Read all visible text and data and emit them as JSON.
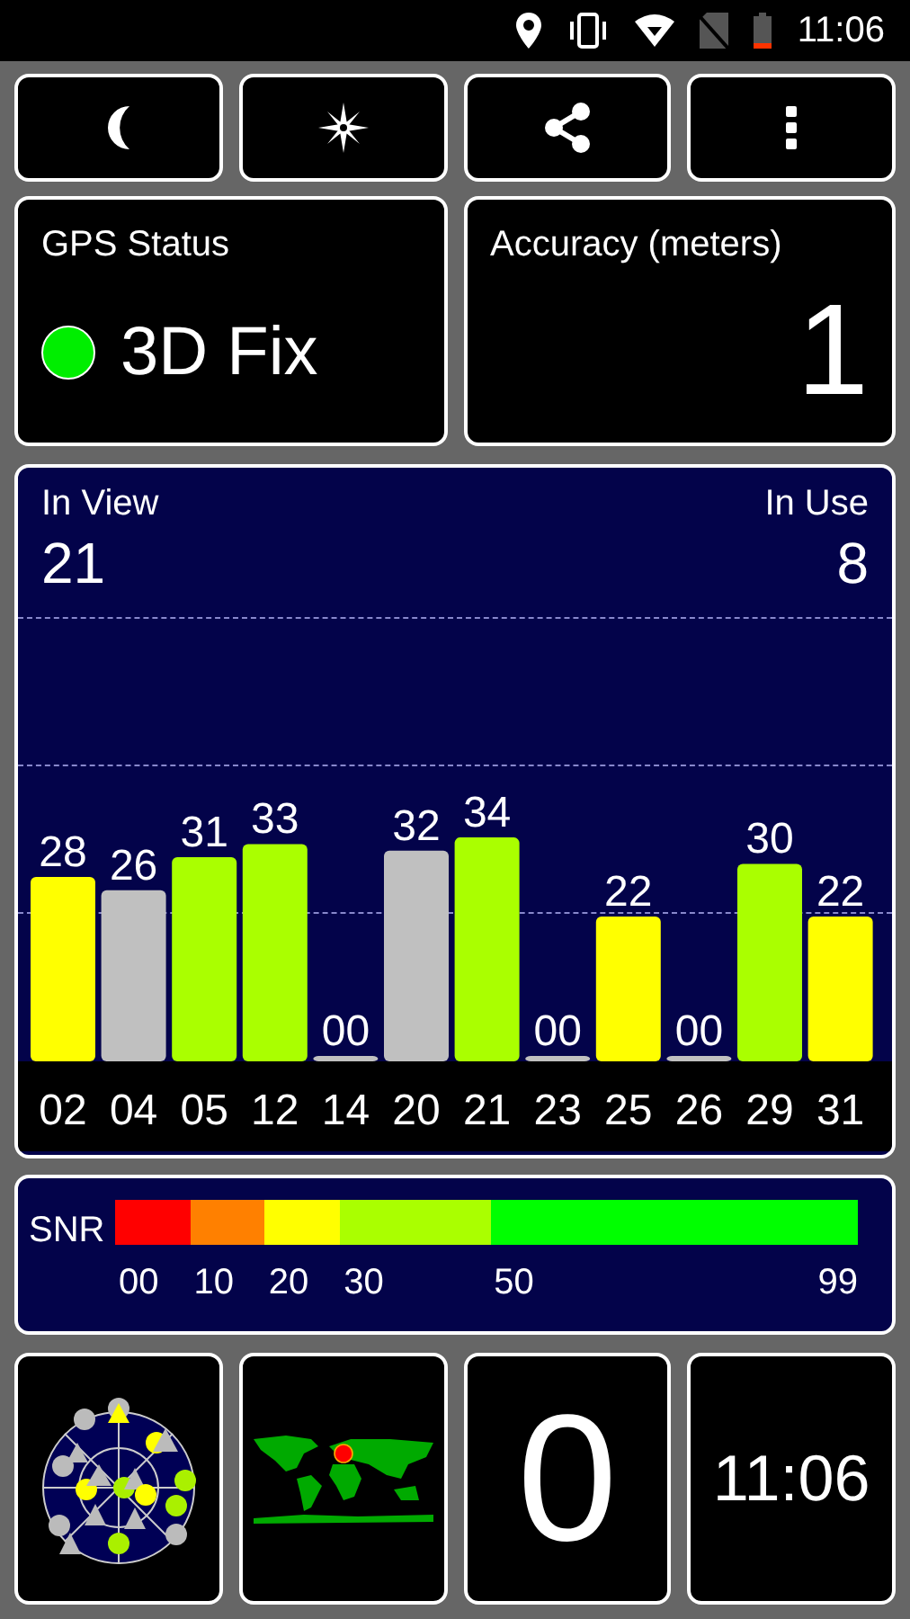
{
  "status_bar": {
    "time": "11:06"
  },
  "toolbar": {
    "buttons": [
      {
        "kind": "night"
      },
      {
        "kind": "compass"
      },
      {
        "kind": "share"
      },
      {
        "kind": "more"
      }
    ]
  },
  "gps_status": {
    "title": "GPS Status",
    "fix": "3D Fix",
    "color": "#00ee00"
  },
  "accuracy": {
    "title": "Accuracy (meters)",
    "value": "1"
  },
  "satellites": {
    "in_view_label": "In View",
    "in_view": "21",
    "in_use_label": "In Use",
    "in_use": "8",
    "in_use_flags": [
      true,
      false,
      true,
      true,
      false,
      false,
      true,
      false,
      true,
      false,
      true,
      true
    ],
    "chart_data": {
      "type": "bar",
      "categories": [
        "02",
        "04",
        "05",
        "12",
        "14",
        "20",
        "21",
        "23",
        "25",
        "26",
        "29",
        "31"
      ],
      "values": [
        28,
        26,
        31,
        33,
        0,
        32,
        34,
        0,
        22,
        0,
        30,
        22
      ],
      "value_labels": [
        "28",
        "26",
        "31",
        "33",
        "00",
        "32",
        "34",
        "00",
        "22",
        "00",
        "30",
        "22"
      ],
      "data_labels": true
    }
  },
  "snr_legend": {
    "label": "SNR",
    "end": "99",
    "segments": [
      {
        "from": "00",
        "color": "#ff0000"
      },
      {
        "from": "10",
        "color": "#ff8000"
      },
      {
        "from": "20",
        "color": "#ffff00"
      },
      {
        "from": "30",
        "color": "#aaff00"
      },
      {
        "from": "50",
        "color": "#00ff00"
      }
    ]
  },
  "tiles": {
    "sats_in_use_count": "0",
    "clock": "11:06"
  }
}
